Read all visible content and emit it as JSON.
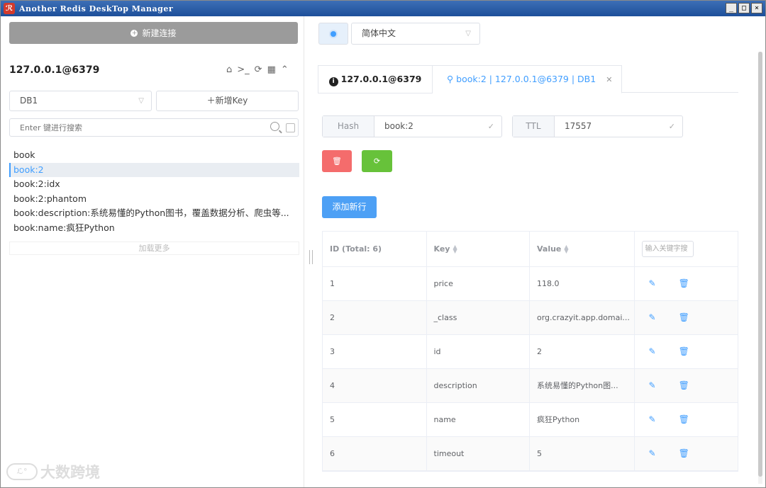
{
  "window": {
    "title": "Another Redis DeskTop Manager",
    "logo": "ℛ",
    "btn_min": "_",
    "btn_max": "□",
    "btn_close": "×"
  },
  "left": {
    "new_connection": "新建连接",
    "connection_name": "127.0.0.1@6379",
    "db_select": "DB1",
    "add_key": "＋新增Key",
    "search_placeholder": "Enter 键进行搜索",
    "keys": [
      "book",
      "book:2",
      "book:2:idx",
      "book:2:phantom",
      "book:description:系统易懂的Python图书，覆盖数据分析、爬虫等...",
      "book:name:疯狂Python"
    ],
    "selected_key_index": 1,
    "load_more": "加载更多",
    "watermark": "大数跨境"
  },
  "right": {
    "language": "简体中文",
    "tabs": [
      {
        "label": "127.0.0.1@6379"
      },
      {
        "label": "book:2 | 127.0.0.1@6379 | DB1"
      }
    ],
    "key_type": "Hash",
    "key_name": "book:2",
    "ttl_label": "TTL",
    "ttl_value": "17557",
    "add_row": "添加新行",
    "table": {
      "headers": [
        "ID (Total: 6)",
        "Key",
        "Value"
      ],
      "keyword_placeholder": "输入关键字搜",
      "rows": [
        {
          "id": "1",
          "key": "price",
          "value": "118.0"
        },
        {
          "id": "2",
          "key": "_class",
          "value": "org.crazyit.app.domai..."
        },
        {
          "id": "3",
          "key": "id",
          "value": "2"
        },
        {
          "id": "4",
          "key": "description",
          "value": "系统易懂的Python图..."
        },
        {
          "id": "5",
          "key": "name",
          "value": "疯狂Python"
        },
        {
          "id": "6",
          "key": "timeout",
          "value": "5"
        }
      ]
    }
  },
  "colors": {
    "accent": "#409eff",
    "danger": "#f46c6c",
    "success": "#67c23a",
    "titlebar": "#2a5ca8"
  }
}
